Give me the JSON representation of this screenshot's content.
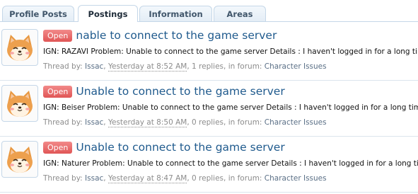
{
  "tabs": [
    {
      "label": "Profile Posts"
    },
    {
      "label": "Postings"
    },
    {
      "label": "Information"
    },
    {
      "label": "Areas"
    }
  ],
  "posts": [
    {
      "badge": "Open",
      "title": "nable to connect to the game server",
      "snippet": "IGN: RAZAVI Problem: Unable to connect to the game server Details : I haven't logged in for a long time.",
      "prefix": "Thread by: ",
      "author": "Issac",
      "sep1": ", ",
      "date": "Yesterday at 8:52 AM",
      "sep2": ", 1 replies, in forum: ",
      "forum": "Character Issues"
    },
    {
      "badge": "Open",
      "title": "Unable to connect to the game server",
      "snippet": "IGN: Beiser Problem: Unable to connect to the game server Details : I haven't logged in for a long time.",
      "prefix": "Thread by: ",
      "author": "Issac",
      "sep1": ", ",
      "date": "Yesterday at 8:50 AM",
      "sep2": ", 0 replies, in forum: ",
      "forum": "Character Issues"
    },
    {
      "badge": "Open",
      "title": "Unable to connect to the game server",
      "snippet": "IGN: Naturer Problem: Unable to connect to the game server Details : I haven't logged in for a long time.",
      "prefix": "Thread by: ",
      "author": "Issac",
      "sep1": ", ",
      "date": "Yesterday at 8:47 AM",
      "sep2": ", 0 replies, in forum: ",
      "forum": "Character Issues"
    }
  ],
  "colors": {
    "accent": "#1f5a8d",
    "badge": "#e05555",
    "border": "#c5d7e8"
  },
  "icons": {
    "avatar": "shiba-dog-avatar"
  }
}
